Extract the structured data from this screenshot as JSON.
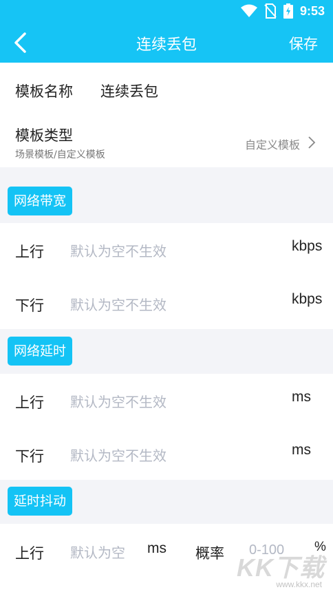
{
  "status_bar": {
    "time": "9:53",
    "icons": [
      "wifi-icon",
      "no-sim-icon",
      "battery-charging-icon"
    ]
  },
  "header": {
    "title": "连续丢包",
    "save_label": "保存",
    "back_icon": "chevron-left-icon"
  },
  "template": {
    "name_label": "模板名称",
    "name_value": "连续丢包",
    "type_label": "模板类型",
    "type_sub": "场景模板/自定义模板",
    "type_value": "自定义模板"
  },
  "sections": [
    {
      "tag": "网络带宽",
      "rows": [
        {
          "label": "上行",
          "placeholder": "默认为空不生效",
          "unit": "kbps"
        },
        {
          "label": "下行",
          "placeholder": "默认为空不生效",
          "unit": "kbps"
        }
      ]
    },
    {
      "tag": "网络延时",
      "rows": [
        {
          "label": "上行",
          "placeholder": "默认为空不生效",
          "unit": "ms"
        },
        {
          "label": "下行",
          "placeholder": "默认为空不生效",
          "unit": "ms"
        }
      ]
    },
    {
      "tag": "延时抖动",
      "rows": [
        {
          "label": "上行",
          "placeholder": "默认为空",
          "unit": "ms",
          "prob_label": "概率",
          "prob_placeholder": "0-100",
          "prob_unit": "%"
        }
      ]
    }
  ],
  "watermark": {
    "logo": "KK下载",
    "url": "www.kkx.net"
  },
  "colors": {
    "accent": "#16c4f5",
    "background": "#f3f4f8",
    "placeholder": "#b3b8c4"
  }
}
